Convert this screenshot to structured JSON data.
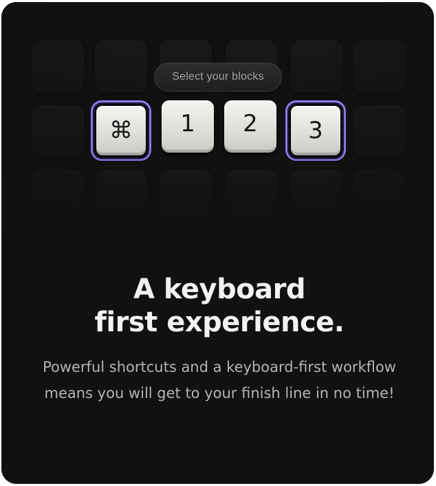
{
  "selector": {
    "label": "Select your blocks"
  },
  "keys": [
    {
      "label": "⌘",
      "selected": true
    },
    {
      "label": "1",
      "selected": false
    },
    {
      "label": "2",
      "selected": false
    },
    {
      "label": "3",
      "selected": true
    }
  ],
  "headline": {
    "line1": "A keyboard",
    "line2": "first experience."
  },
  "description": "Powerful shortcuts and a keyboard-first workflow means you will get to your finish line in no time!",
  "colors": {
    "background": "#111111",
    "selection_ring": "#8b7cf2",
    "key_face": "#e8e8e4",
    "headline": "#f2f2f2",
    "body": "#b5b5b5"
  }
}
